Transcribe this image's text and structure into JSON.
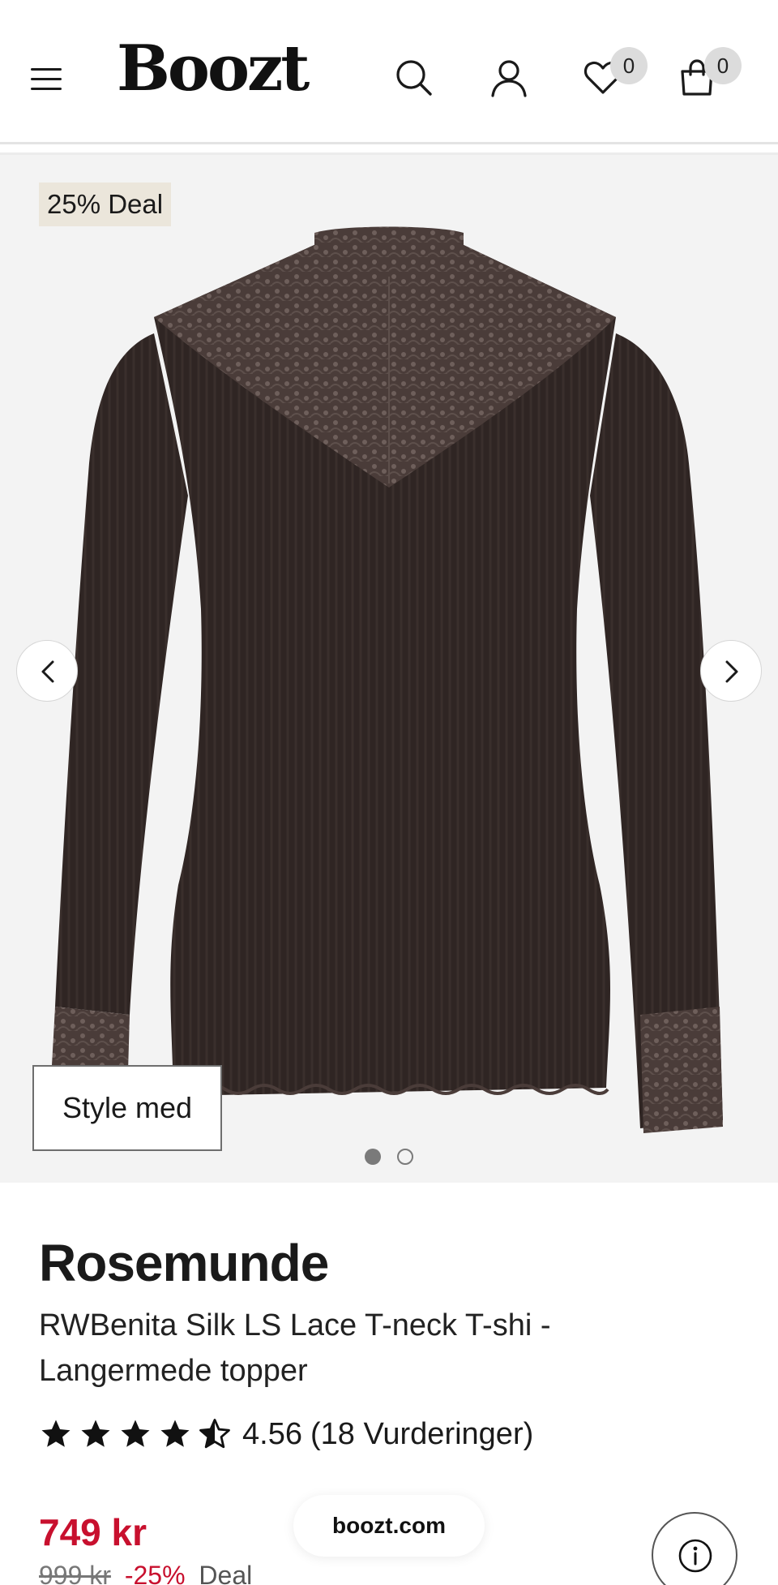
{
  "header": {
    "logo": "Boozt",
    "wishlist_count": "0",
    "cart_count": "0"
  },
  "gallery": {
    "deal_badge": "25% Deal",
    "style_button_label": "Style med",
    "current_image": 1,
    "image_count": 2,
    "product_color": "#2f2523"
  },
  "product": {
    "brand": "Rosemunde",
    "name": "RWBenita Silk LS Lace T-neck T-shi - Langermede topper",
    "rating_value": "4.56",
    "rating_count": "(18 Vurderinger)",
    "rating_stars": 4.56,
    "price": "749 kr",
    "old_price": "999 kr",
    "discount": "-25%",
    "deal_label": "Deal"
  },
  "footer": {
    "url_label": "boozt.com"
  },
  "colors": {
    "accent_red": "#c8102e",
    "deal_badge_bg": "#ebe6db",
    "gallery_bg": "#f3f3f3"
  }
}
